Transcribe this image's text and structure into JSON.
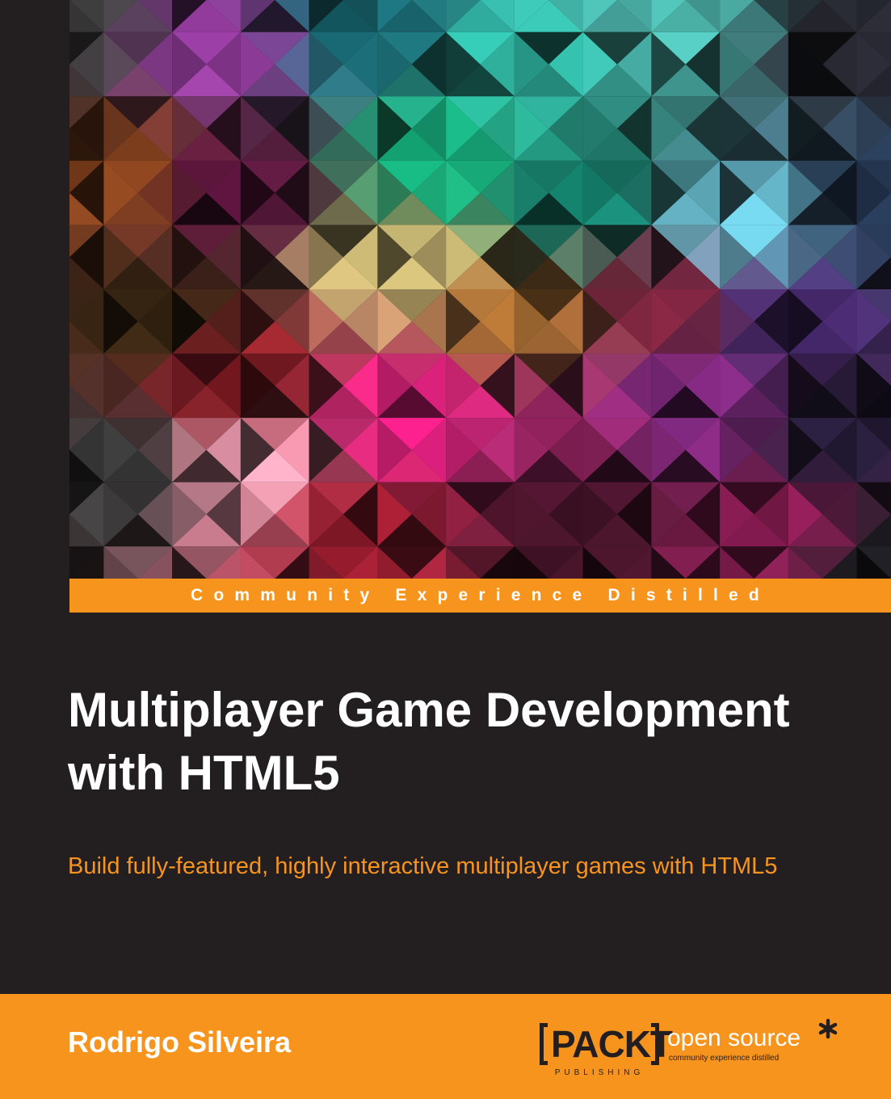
{
  "cover": {
    "tagline": "Community Experience Distilled",
    "title": "Multiplayer Game Development with HTML5",
    "subtitle": "Build fully-featured, highly interactive multiplayer games with HTML5",
    "author": "Rodrigo Silveira"
  },
  "publisher": {
    "logo_text": "PACKT",
    "logo_subtext": "PUBLISHING",
    "imprint": "open source",
    "imprint_tagline": "community experience distilled"
  },
  "colors": {
    "background": "#231f20",
    "accent": "#f7941d",
    "title": "#ffffff"
  }
}
